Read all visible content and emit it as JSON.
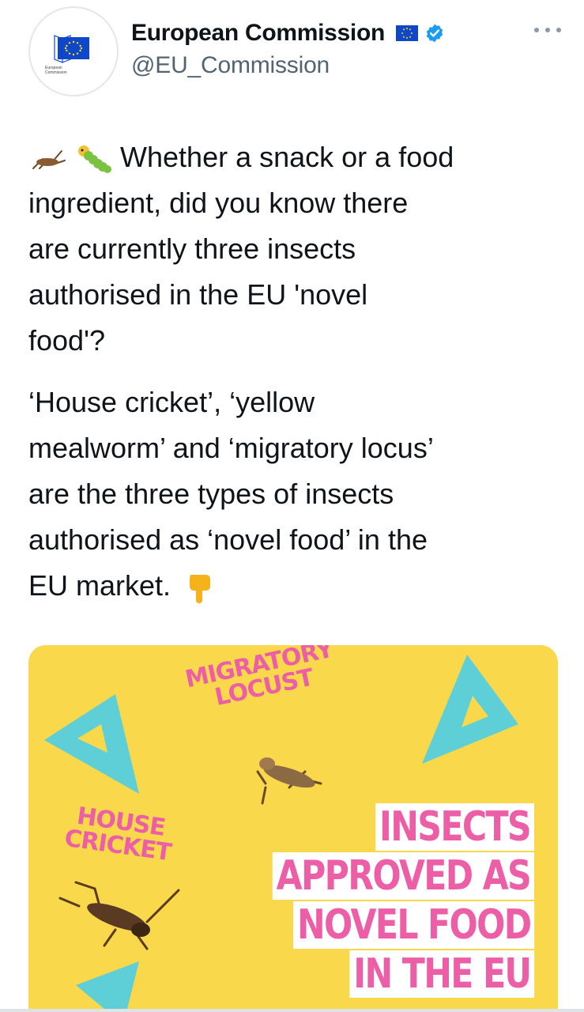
{
  "author": {
    "display_name": "European Commission",
    "handle": "@EU_Commission",
    "avatar_caption": [
      "European",
      "Commission"
    ]
  },
  "tweet": {
    "paragraph1_lines": [
      "Whether a snack or a food",
      "ingredient, did you know there",
      "are currently three insects",
      "authorised in the EU 'novel",
      "food'?"
    ],
    "paragraph2_lines": [
      "‘House cricket’, ‘yellow",
      "mealworm’ and ‘migratory locus’",
      "are the three types of insects",
      "authorised as ‘novel food’ in the",
      "EU market."
    ],
    "emojis": [
      "cricket-emoji",
      "caterpillar-emoji",
      "pointing-down-emoji"
    ]
  },
  "media": {
    "locust_label": [
      "MIGRATORY",
      "LOCUST"
    ],
    "cricket_label": [
      "HOUSE",
      "CRICKET"
    ],
    "headline_lines": [
      "INSECTS",
      "APPROVED AS",
      "NOVEL FOOD",
      "IN THE EU"
    ]
  },
  "colors": {
    "background_yellow": "#f9d84b",
    "accent_pink": "#ec5fa6",
    "triangle_teal": "#5ecfd6",
    "verified_blue": "#1d9bf0",
    "handle_gray": "#536471"
  }
}
